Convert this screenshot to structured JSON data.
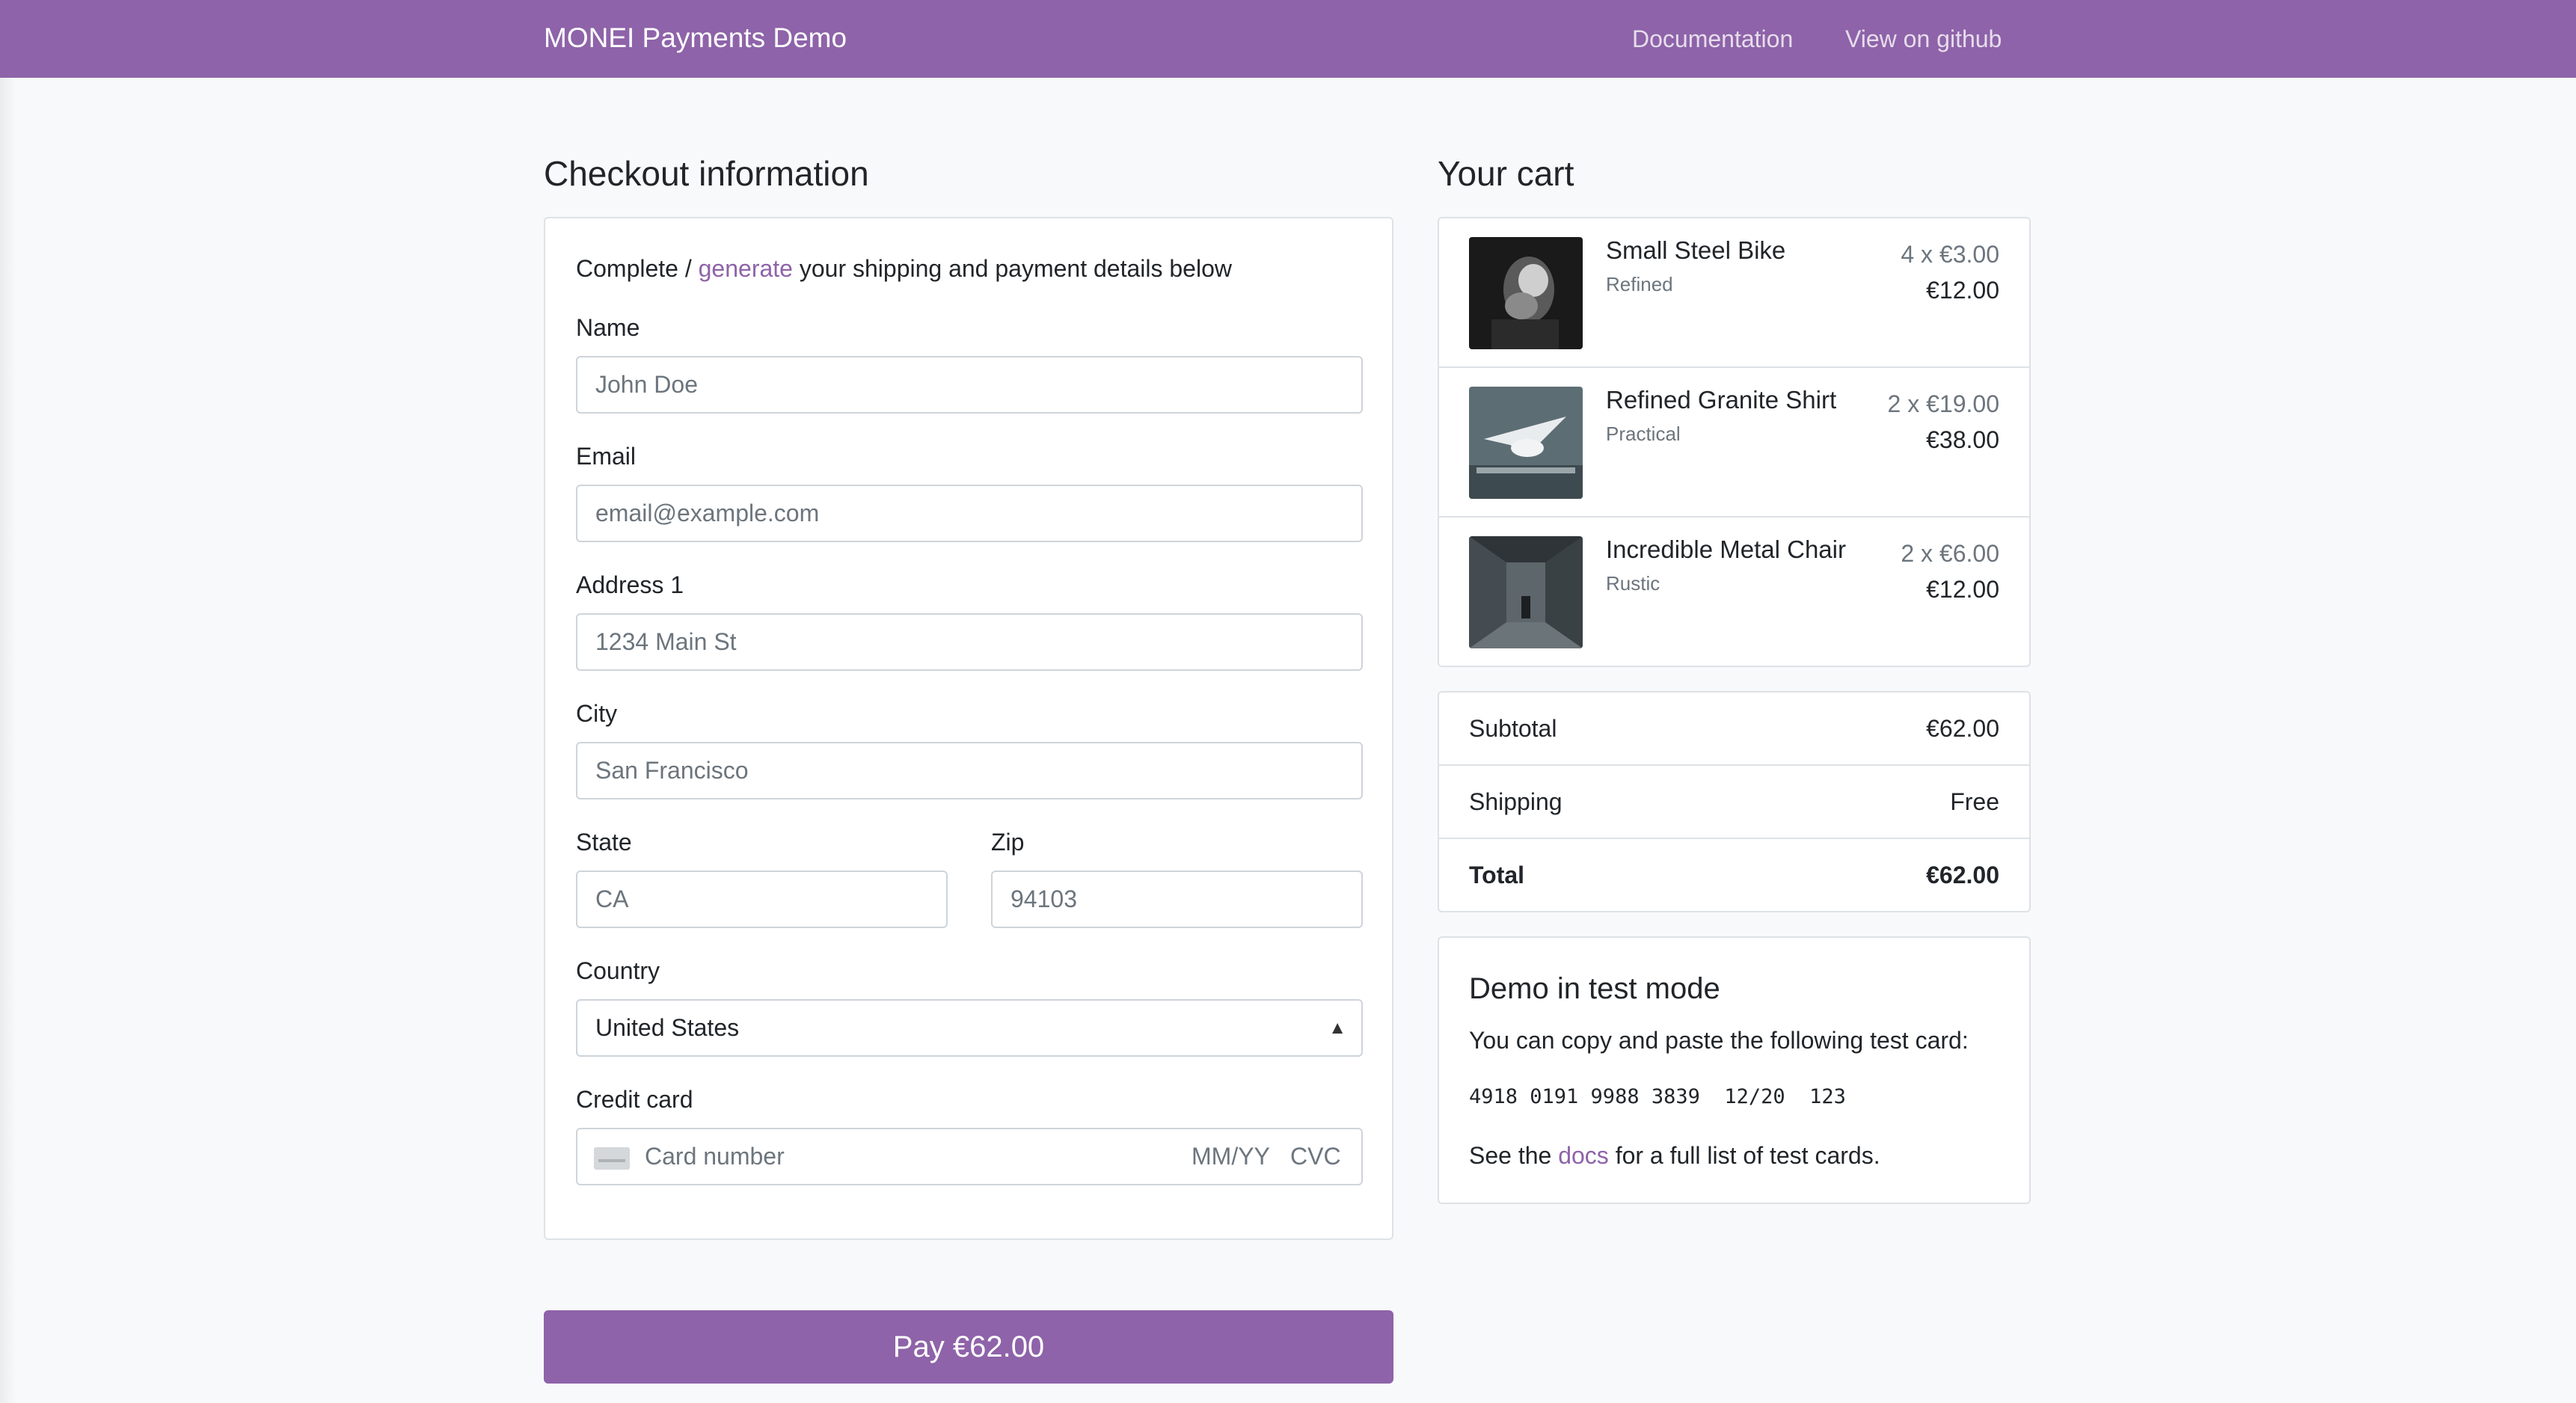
{
  "header": {
    "brand": "MONEI Payments Demo",
    "nav": {
      "documentation": "Documentation",
      "github": "View on github"
    }
  },
  "checkout": {
    "title": "Checkout information",
    "intro_prefix": "Complete / ",
    "intro_link": "generate",
    "intro_suffix": " your shipping and payment details below",
    "fields": {
      "name": {
        "label": "Name",
        "placeholder": "John Doe"
      },
      "email": {
        "label": "Email",
        "placeholder": "email@example.com"
      },
      "address1": {
        "label": "Address 1",
        "placeholder": "1234 Main St"
      },
      "city": {
        "label": "City",
        "placeholder": "San Francisco"
      },
      "state": {
        "label": "State",
        "placeholder": "CA"
      },
      "zip": {
        "label": "Zip",
        "placeholder": "94103"
      },
      "country": {
        "label": "Country",
        "value": "United States"
      },
      "credit_card": {
        "label": "Credit card",
        "number_placeholder": "Card number",
        "expiry_placeholder": "MM/YY",
        "cvc_placeholder": "CVC"
      }
    },
    "pay_button": "Pay €62.00"
  },
  "cart": {
    "title": "Your cart",
    "items": [
      {
        "name": "Small Steel Bike",
        "variant": "Refined",
        "unit": "4 x €3.00",
        "total": "€12.00",
        "image": "dark-figure-image"
      },
      {
        "name": "Refined Granite Shirt",
        "variant": "Practical",
        "unit": "2 x €19.00",
        "total": "€38.00",
        "image": "seagull-image"
      },
      {
        "name": "Incredible Metal Chair",
        "variant": "Rustic",
        "unit": "2 x €6.00",
        "total": "€12.00",
        "image": "corridor-image"
      }
    ],
    "subtotal": {
      "label": "Subtotal",
      "value": "€62.00"
    },
    "shipping": {
      "label": "Shipping",
      "value": "Free"
    },
    "total": {
      "label": "Total",
      "value": "€62.00"
    }
  },
  "demo": {
    "title": "Demo in test mode",
    "text": "You can copy and paste the following test card:",
    "test_card": "4918 0191 9988 3839  12/20  123",
    "footer_prefix": "See the ",
    "footer_link": "docs",
    "footer_suffix": " for a full list of test cards."
  },
  "colors": {
    "brand": "#8e63a9",
    "page_background": "#f8f9fa",
    "border": "#dee2e6"
  }
}
